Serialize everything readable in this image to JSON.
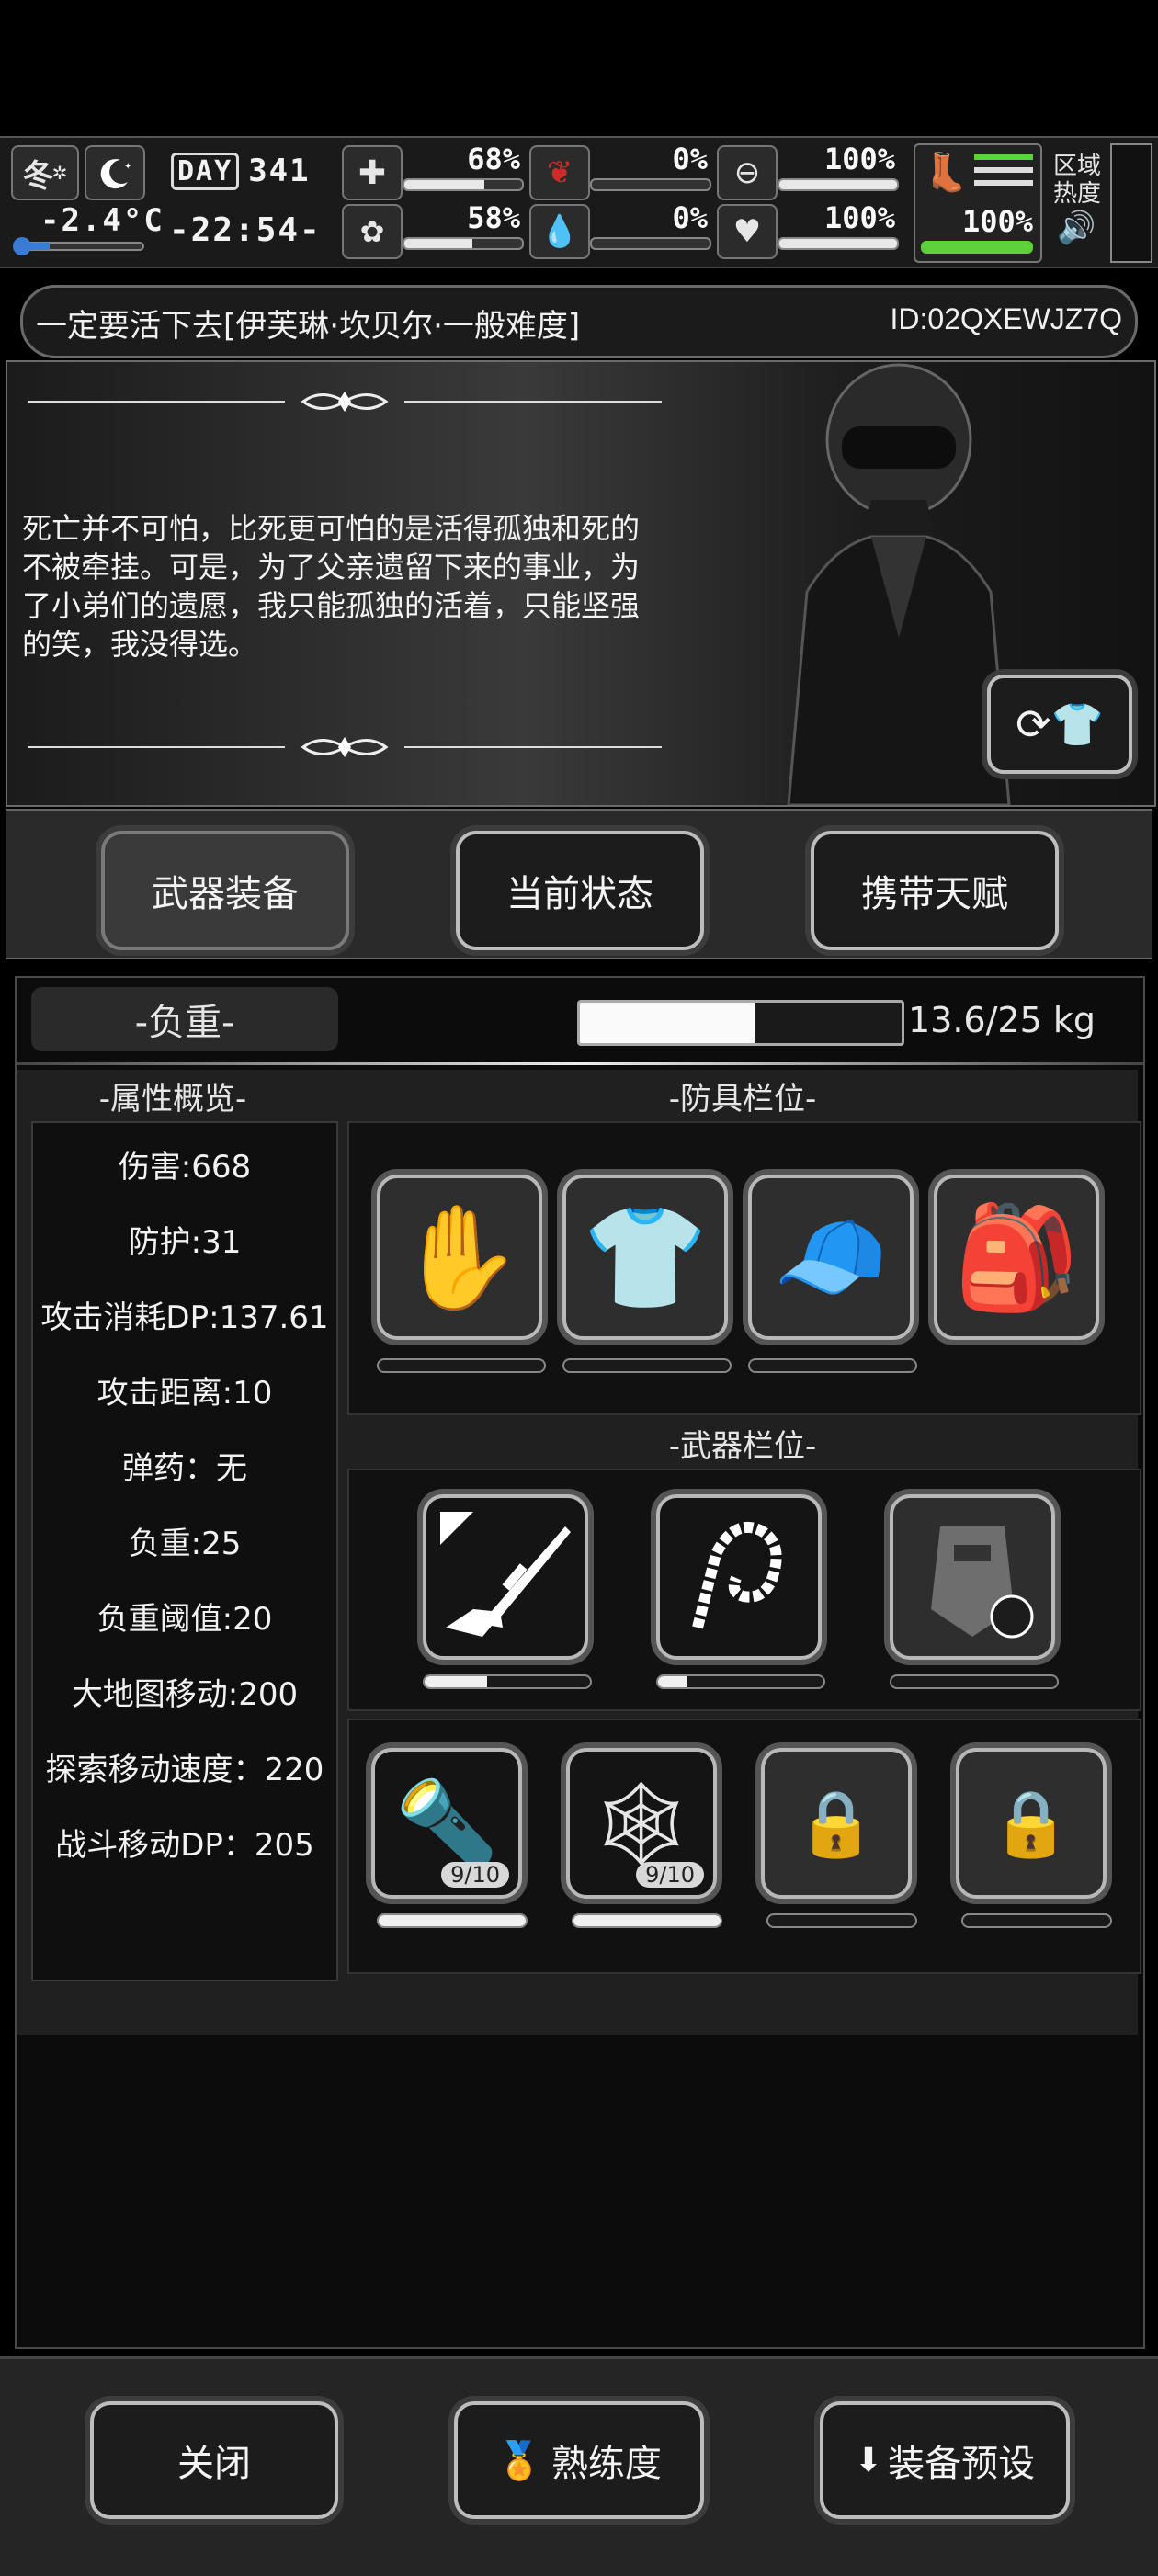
{
  "hud": {
    "season": "冬",
    "temperature": "-2.4°C",
    "day_label": "DAY",
    "day": "341",
    "time": "-22:54-",
    "stats": [
      {
        "name": "health",
        "value": "68%",
        "fill": 0.68
      },
      {
        "name": "hunger",
        "value": "0%",
        "fill": 0.0
      },
      {
        "name": "thirst",
        "value": "100%",
        "fill": 1.0
      },
      {
        "name": "stamina",
        "value": "100%",
        "fill": 1.0
      },
      {
        "name": "mood",
        "value": "58%",
        "fill": 0.58
      },
      {
        "name": "blood",
        "value": "0%",
        "fill": 0.0
      },
      {
        "name": "heart",
        "value": "100%",
        "fill": 1.0
      },
      {
        "name": "boots",
        "value": "100%",
        "fill": 1.0
      }
    ],
    "zone_label_1": "区域",
    "zone_label_2": "热度",
    "accent": "#4caf2a"
  },
  "title": {
    "text": "一定要活下去[伊芙琳·坎贝尔·一般难度]",
    "id": "ID:02QXEWJZ7Q"
  },
  "story": {
    "quote": "死亡并不可怕，比死更可怕的是活得孤独和死的不被牵挂。可是，为了父亲遗留下来的事业，为了小弟们的遗愿，我只能孤独的活着，只能坚强的笑，我没得选。"
  },
  "tabs": [
    {
      "label": "武器装备",
      "active": true
    },
    {
      "label": "当前状态",
      "active": false
    },
    {
      "label": "携带天赋",
      "active": false
    }
  ],
  "weight": {
    "label": "-负重-",
    "value": "13.6/25 kg",
    "fill": 0.544
  },
  "attributes": {
    "title": "-属性概览-",
    "items": [
      "伤害:668",
      "防护:31",
      "攻击消耗DP:137.61",
      "攻击距离:10",
      "弹药：无",
      "负重:25",
      "负重阈值:20",
      "大地图移动:200",
      "探索移动速度：220",
      "战斗移动DP：205"
    ]
  },
  "armor": {
    "title": "-防具栏位-",
    "slots": [
      {
        "icon": "gloves-icon",
        "fill": 0
      },
      {
        "icon": "shirt-icon",
        "fill": 0
      },
      {
        "icon": "visor-cap-icon",
        "fill": 0
      },
      {
        "icon": "backpack-icon",
        "fill": 0
      }
    ]
  },
  "weapons": {
    "title": "-武器栏位-",
    "slots": [
      {
        "icon": "sniper-rifle-icon",
        "fill": 0.38
      },
      {
        "icon": "chain-whip-icon",
        "fill": 0.18
      },
      {
        "icon": "riot-shield-icon",
        "fill": 0
      }
    ],
    "items": [
      {
        "icon": "flashlight-icon",
        "count": "9/10",
        "fill": 1.0
      },
      {
        "icon": "net-trap-icon",
        "count": "9/10",
        "fill": 1.0
      },
      {
        "icon": "locked-slot-icon",
        "count": "",
        "fill": 0
      },
      {
        "icon": "locked-slot-icon",
        "count": "",
        "fill": 0
      }
    ]
  },
  "footer": {
    "close": "关闭",
    "proficiency": "熟练度",
    "preset": "装备预设"
  }
}
